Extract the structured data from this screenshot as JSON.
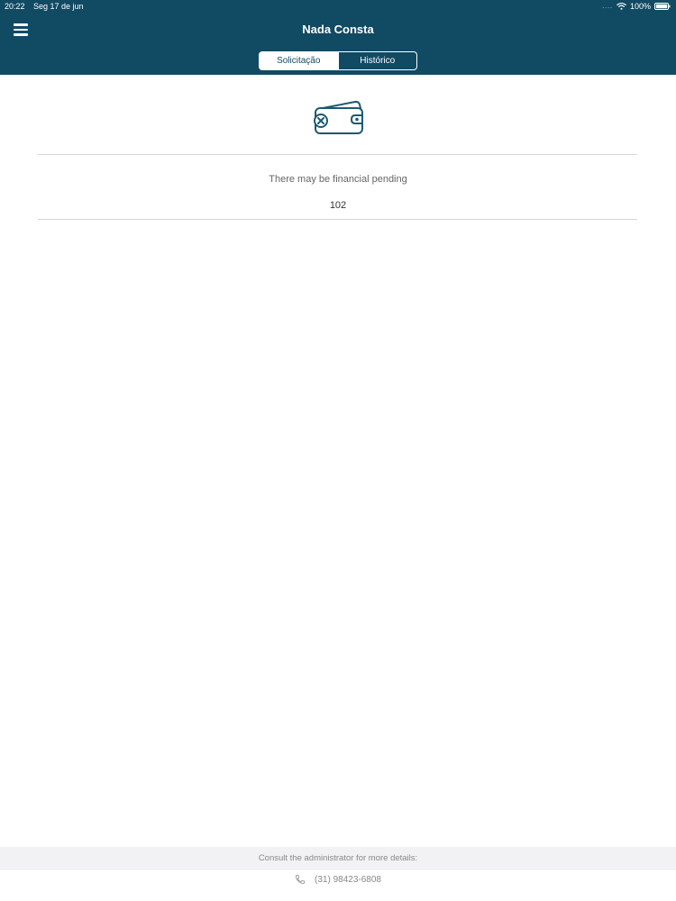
{
  "status_bar": {
    "time": "20:22",
    "date": "Seg 17 de jun",
    "signal": "....",
    "battery": "100%"
  },
  "header": {
    "title": "Nada Consta",
    "background_color": "#114a63",
    "tabs": [
      {
        "label": "Solicitação",
        "selected": true
      },
      {
        "label": "Histórico",
        "selected": false
      }
    ]
  },
  "main": {
    "icon": "wallet-x-icon",
    "message": "There may be financial pending",
    "code": "102"
  },
  "footer": {
    "note": "Consult the administrator for more details:",
    "phone_icon": "phone-icon",
    "phone": "(31) 98423-6808"
  }
}
